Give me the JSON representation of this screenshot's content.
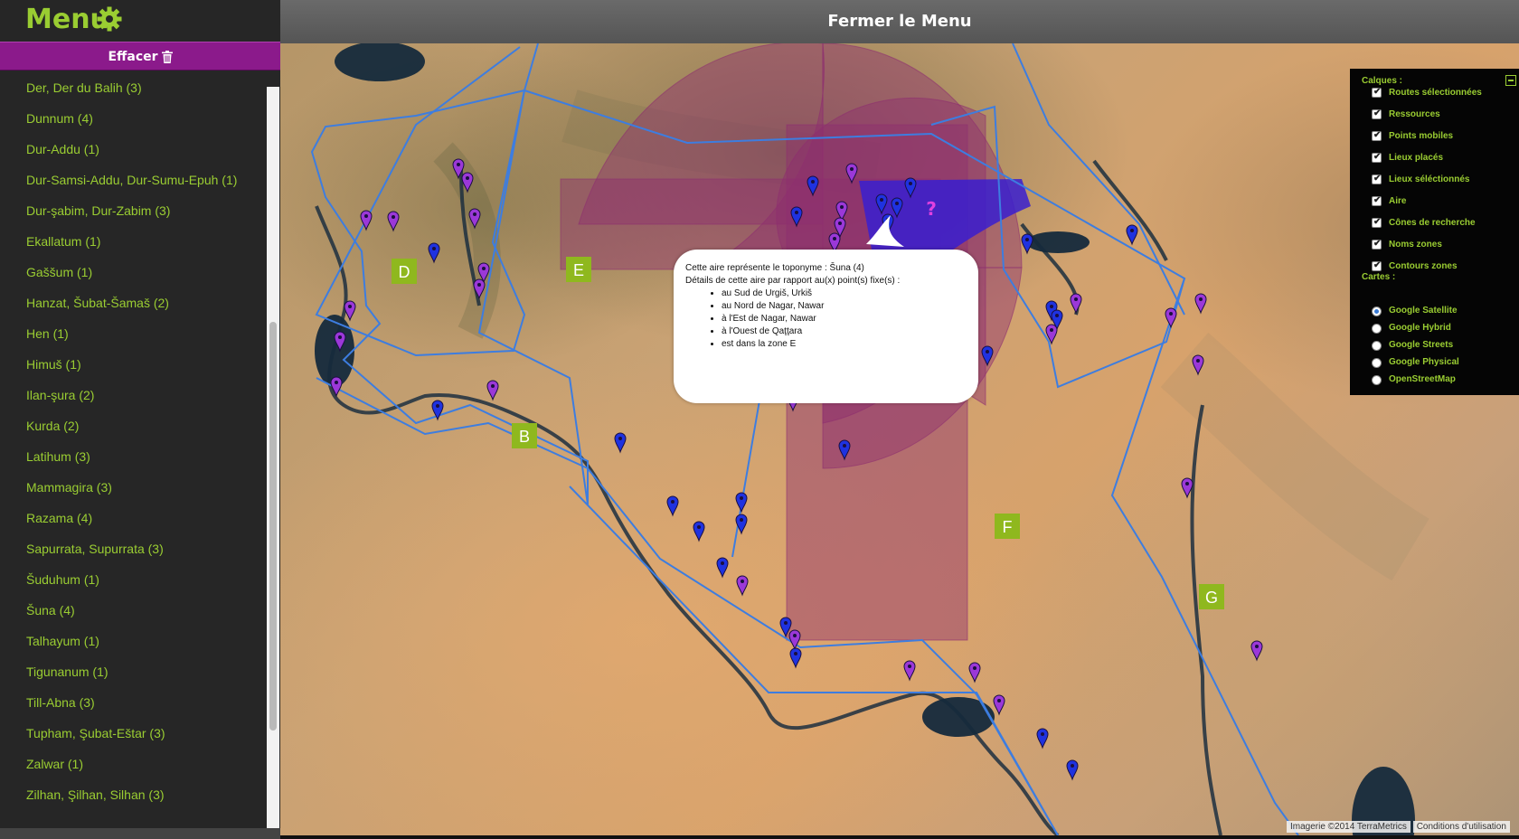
{
  "sidebar": {
    "title": "Menu",
    "clear_label": "Effacer",
    "items": [
      {
        "label": "Der, Der du Balih (3)"
      },
      {
        "label": "Dunnum (4)"
      },
      {
        "label": "Dur-Addu (1)"
      },
      {
        "label": "Dur-Samsi-Addu, Dur-Sumu-Epuh (1)"
      },
      {
        "label": "Dur-şabim, Dur-Zabim (3)"
      },
      {
        "label": "Ekallatum (1)"
      },
      {
        "label": "Gaššum (1)"
      },
      {
        "label": "Hanzat, Šubat-Šamaš (2)"
      },
      {
        "label": "Hen (1)"
      },
      {
        "label": "Himuš (1)"
      },
      {
        "label": "Ilan-şura (2)"
      },
      {
        "label": "Kurda (2)"
      },
      {
        "label": "Latihum (3)"
      },
      {
        "label": "Mammagira (3)"
      },
      {
        "label": "Razama (4)"
      },
      {
        "label": "Sapurrata, Supurrata (3)"
      },
      {
        "label": "Šuduhum (1)"
      },
      {
        "label": "Šuna (4)"
      },
      {
        "label": "Talhayum (1)"
      },
      {
        "label": "Tigunanum (1)"
      },
      {
        "label": "Till-Abna (3)"
      },
      {
        "label": "Tupham, Şubat-Eštar (3)"
      },
      {
        "label": "Zalwar (1)"
      },
      {
        "label": "Zilhan, Şilhan, Silhan (3)"
      }
    ]
  },
  "topbar": {
    "label": "Fermer le Menu"
  },
  "popup": {
    "line1": "Cette aire représente le toponyme : Šuna (4)",
    "line2": "Détails de cette aire par rapport au(x) point(s) fixe(s) :",
    "bullets": [
      "au Sud de    Urgiš, Urkiš",
      "au Nord de    Nagar, Nawar",
      "à l'Est de    Nagar, Nawar",
      "à l'Ouest de    Qaţţara",
      "est dans la zone E"
    ],
    "question_mark": "?"
  },
  "zones": [
    {
      "label": "D"
    },
    {
      "label": "E"
    },
    {
      "label": "B"
    },
    {
      "label": "F"
    },
    {
      "label": "G"
    }
  ],
  "layers": {
    "calques_title": "Calques :",
    "items": [
      {
        "label": "Routes sélectionnées",
        "checked": true
      },
      {
        "label": "Ressources",
        "checked": true
      },
      {
        "label": "Points mobiles",
        "checked": true
      },
      {
        "label": "Lieux placés",
        "checked": true
      },
      {
        "label": "Lieux séléctionnés",
        "checked": true
      },
      {
        "label": "Aire",
        "checked": true
      },
      {
        "label": "Cônes de recherche",
        "checked": true
      },
      {
        "label": "Noms zones",
        "checked": true
      },
      {
        "label": "Contours zones",
        "checked": true
      }
    ],
    "cartes_title": "Cartes :",
    "maps": [
      {
        "label": "Google Satellite",
        "selected": true
      },
      {
        "label": "Google Hybrid",
        "selected": false
      },
      {
        "label": "Google Streets",
        "selected": false
      },
      {
        "label": "Google Physical",
        "selected": false
      },
      {
        "label": "OpenStreetMap",
        "selected": false
      }
    ]
  },
  "attribution": {
    "imagery": "Imagerie ©2014 TerraMetrics",
    "terms": "Conditions d'utilisation"
  },
  "colors": {
    "menu_green": "#9acd32",
    "clear_button": "#8b1a8b",
    "zone_line": "#3d7de0",
    "area_fill": "#8e2e6f",
    "selected_area": "#3a1fd0",
    "zone_label_bg": "#8fb81e"
  }
}
